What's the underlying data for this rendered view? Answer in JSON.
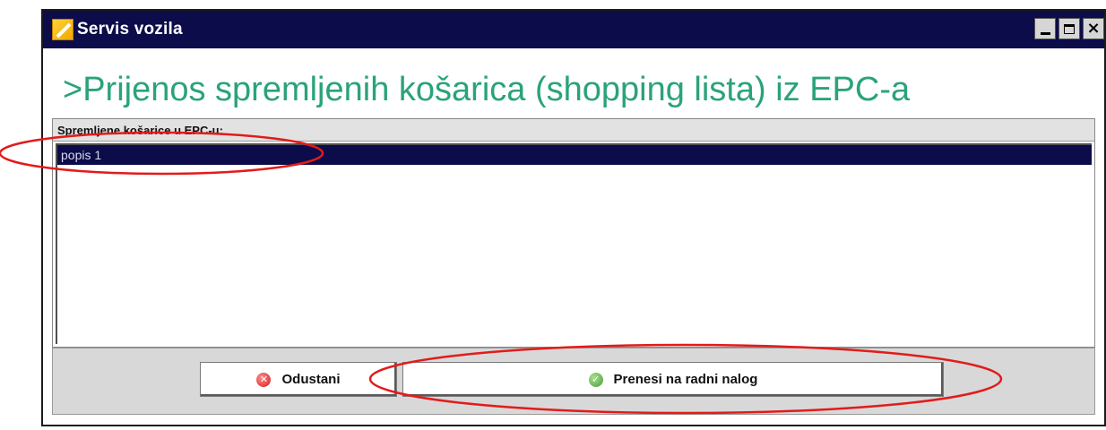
{
  "window": {
    "title": "Servis vozila"
  },
  "heading": ">Prijenos spremljenih košarica (shopping lista) iz EPC-a",
  "list": {
    "header": "Spremljene košarice u EPC-u:",
    "items": [
      {
        "label": "popis 1",
        "selected": true
      }
    ]
  },
  "buttons": {
    "cancel_label": "Odustani",
    "transfer_label": "Prenesi na radni nalog"
  },
  "icons": {
    "app": "app-icon",
    "minimize": "minimize-icon",
    "maximize": "maximize-icon",
    "close": "close-icon",
    "cancel": "cancel-icon",
    "ok": "check-icon"
  },
  "colors": {
    "title_bar": "#0c0c4a",
    "heading": "#2aa37a",
    "selection": "#0c0c4a",
    "annotation": "#e21b1b"
  }
}
